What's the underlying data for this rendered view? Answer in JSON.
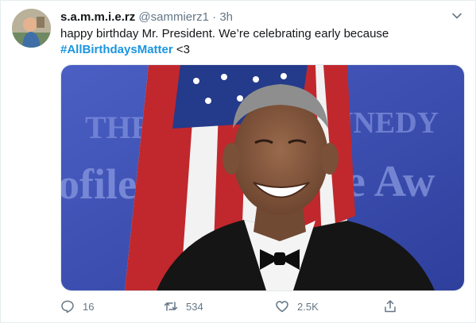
{
  "tweet": {
    "author_name": "s.a.m.m.i.e.rz",
    "handle": "@sammierz1",
    "separator": "·",
    "time": "3h",
    "text": "happy birthday Mr. President. We’re celebrating early because",
    "hashtag": "#AllBirthdaysMatter",
    "text_suffix": " <3"
  },
  "media": {
    "banner_left": "THE",
    "banner_right": "NNEDY",
    "banner_lower_left": "ofile",
    "banner_lower_right": "ge Aw"
  },
  "actions": {
    "replies": "16",
    "retweets": "534",
    "likes": "2.5K"
  },
  "colors": {
    "accent": "#1b95e0",
    "muted": "#657786",
    "banner_blue": "#3a4fb2"
  },
  "icons": [
    "more-caret-icon",
    "reply-icon",
    "retweet-icon",
    "like-icon",
    "share-icon"
  ]
}
